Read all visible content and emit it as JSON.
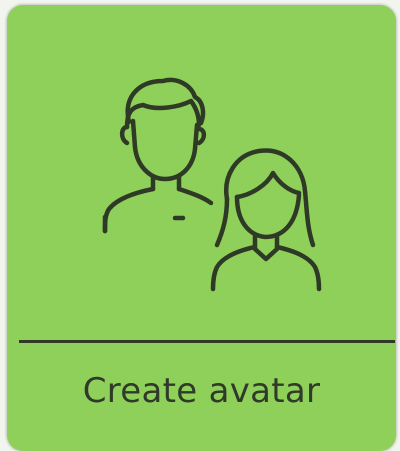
{
  "card": {
    "label": "Create avatar",
    "icon": "people-icon",
    "colors": {
      "card_background": "#8fd05a",
      "line": "#2e3a25",
      "text": "#2f3a28"
    }
  }
}
